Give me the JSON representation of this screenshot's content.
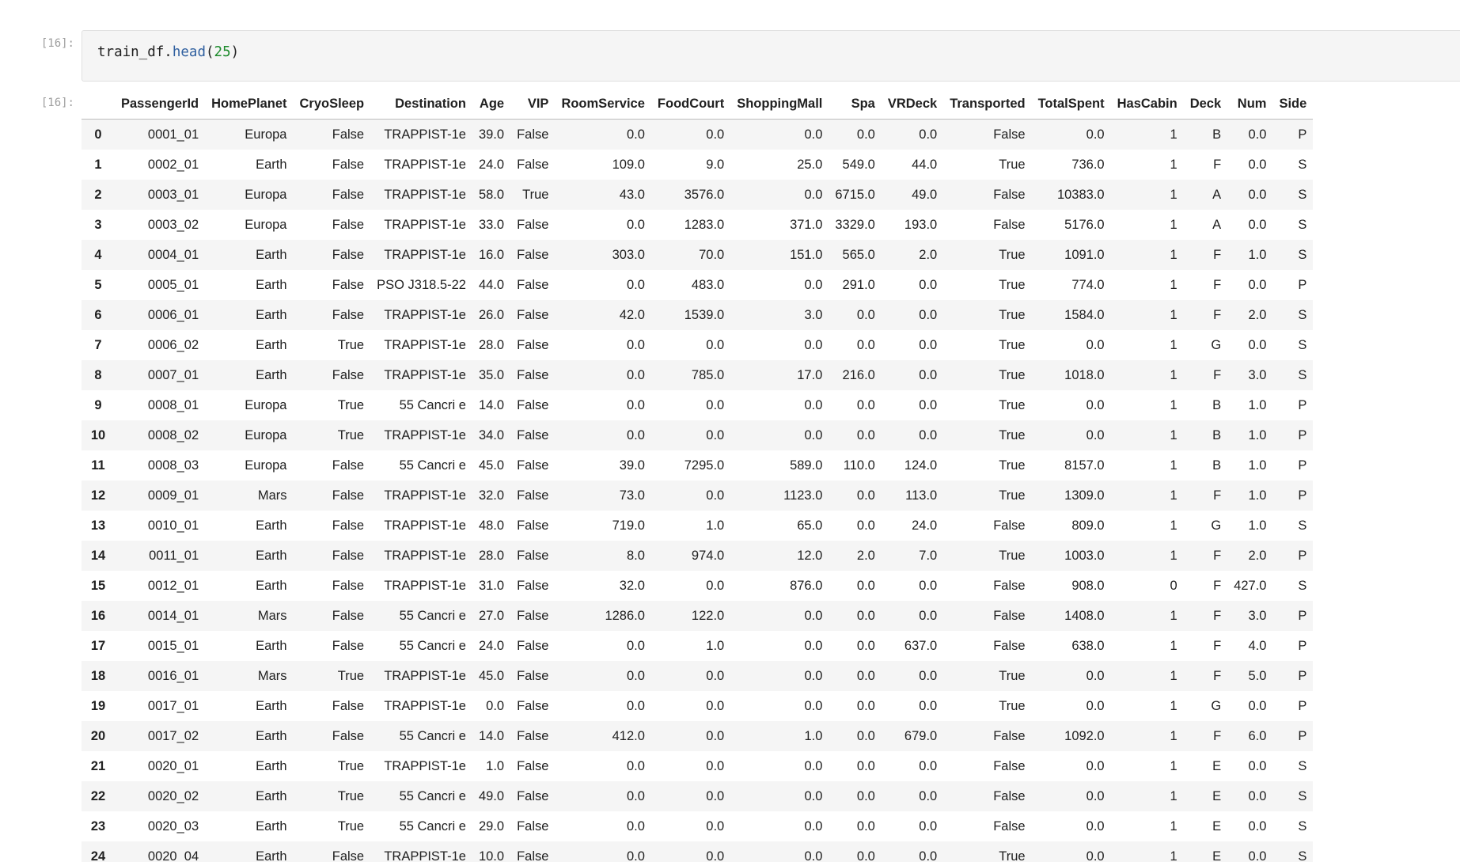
{
  "input_prompt": "[16]:",
  "output_prompt": "[16]:",
  "code": {
    "variable": "train_df",
    "dot": ".",
    "method": "head",
    "open_paren": "(",
    "argument": "25",
    "close_paren": ")"
  },
  "table": {
    "index_header": "",
    "columns": [
      "PassengerId",
      "HomePlanet",
      "CryoSleep",
      "Destination",
      "Age",
      "VIP",
      "RoomService",
      "FoodCourt",
      "ShoppingMall",
      "Spa",
      "VRDeck",
      "Transported",
      "TotalSpent",
      "HasCabin",
      "Deck",
      "Num",
      "Side"
    ],
    "rows": [
      {
        "index": "0",
        "cells": [
          "0001_01",
          "Europa",
          "False",
          "TRAPPIST-1e",
          "39.0",
          "False",
          "0.0",
          "0.0",
          "0.0",
          "0.0",
          "0.0",
          "False",
          "0.0",
          "1",
          "B",
          "0.0",
          "P"
        ]
      },
      {
        "index": "1",
        "cells": [
          "0002_01",
          "Earth",
          "False",
          "TRAPPIST-1e",
          "24.0",
          "False",
          "109.0",
          "9.0",
          "25.0",
          "549.0",
          "44.0",
          "True",
          "736.0",
          "1",
          "F",
          "0.0",
          "S"
        ]
      },
      {
        "index": "2",
        "cells": [
          "0003_01",
          "Europa",
          "False",
          "TRAPPIST-1e",
          "58.0",
          "True",
          "43.0",
          "3576.0",
          "0.0",
          "6715.0",
          "49.0",
          "False",
          "10383.0",
          "1",
          "A",
          "0.0",
          "S"
        ]
      },
      {
        "index": "3",
        "cells": [
          "0003_02",
          "Europa",
          "False",
          "TRAPPIST-1e",
          "33.0",
          "False",
          "0.0",
          "1283.0",
          "371.0",
          "3329.0",
          "193.0",
          "False",
          "5176.0",
          "1",
          "A",
          "0.0",
          "S"
        ]
      },
      {
        "index": "4",
        "cells": [
          "0004_01",
          "Earth",
          "False",
          "TRAPPIST-1e",
          "16.0",
          "False",
          "303.0",
          "70.0",
          "151.0",
          "565.0",
          "2.0",
          "True",
          "1091.0",
          "1",
          "F",
          "1.0",
          "S"
        ]
      },
      {
        "index": "5",
        "cells": [
          "0005_01",
          "Earth",
          "False",
          "PSO J318.5-22",
          "44.0",
          "False",
          "0.0",
          "483.0",
          "0.0",
          "291.0",
          "0.0",
          "True",
          "774.0",
          "1",
          "F",
          "0.0",
          "P"
        ]
      },
      {
        "index": "6",
        "cells": [
          "0006_01",
          "Earth",
          "False",
          "TRAPPIST-1e",
          "26.0",
          "False",
          "42.0",
          "1539.0",
          "3.0",
          "0.0",
          "0.0",
          "True",
          "1584.0",
          "1",
          "F",
          "2.0",
          "S"
        ]
      },
      {
        "index": "7",
        "cells": [
          "0006_02",
          "Earth",
          "True",
          "TRAPPIST-1e",
          "28.0",
          "False",
          "0.0",
          "0.0",
          "0.0",
          "0.0",
          "0.0",
          "True",
          "0.0",
          "1",
          "G",
          "0.0",
          "S"
        ]
      },
      {
        "index": "8",
        "cells": [
          "0007_01",
          "Earth",
          "False",
          "TRAPPIST-1e",
          "35.0",
          "False",
          "0.0",
          "785.0",
          "17.0",
          "216.0",
          "0.0",
          "True",
          "1018.0",
          "1",
          "F",
          "3.0",
          "S"
        ]
      },
      {
        "index": "9",
        "cells": [
          "0008_01",
          "Europa",
          "True",
          "55 Cancri e",
          "14.0",
          "False",
          "0.0",
          "0.0",
          "0.0",
          "0.0",
          "0.0",
          "True",
          "0.0",
          "1",
          "B",
          "1.0",
          "P"
        ]
      },
      {
        "index": "10",
        "cells": [
          "0008_02",
          "Europa",
          "True",
          "TRAPPIST-1e",
          "34.0",
          "False",
          "0.0",
          "0.0",
          "0.0",
          "0.0",
          "0.0",
          "True",
          "0.0",
          "1",
          "B",
          "1.0",
          "P"
        ]
      },
      {
        "index": "11",
        "cells": [
          "0008_03",
          "Europa",
          "False",
          "55 Cancri e",
          "45.0",
          "False",
          "39.0",
          "7295.0",
          "589.0",
          "110.0",
          "124.0",
          "True",
          "8157.0",
          "1",
          "B",
          "1.0",
          "P"
        ]
      },
      {
        "index": "12",
        "cells": [
          "0009_01",
          "Mars",
          "False",
          "TRAPPIST-1e",
          "32.0",
          "False",
          "73.0",
          "0.0",
          "1123.0",
          "0.0",
          "113.0",
          "True",
          "1309.0",
          "1",
          "F",
          "1.0",
          "P"
        ]
      },
      {
        "index": "13",
        "cells": [
          "0010_01",
          "Earth",
          "False",
          "TRAPPIST-1e",
          "48.0",
          "False",
          "719.0",
          "1.0",
          "65.0",
          "0.0",
          "24.0",
          "False",
          "809.0",
          "1",
          "G",
          "1.0",
          "S"
        ]
      },
      {
        "index": "14",
        "cells": [
          "0011_01",
          "Earth",
          "False",
          "TRAPPIST-1e",
          "28.0",
          "False",
          "8.0",
          "974.0",
          "12.0",
          "2.0",
          "7.0",
          "True",
          "1003.0",
          "1",
          "F",
          "2.0",
          "P"
        ]
      },
      {
        "index": "15",
        "cells": [
          "0012_01",
          "Earth",
          "False",
          "TRAPPIST-1e",
          "31.0",
          "False",
          "32.0",
          "0.0",
          "876.0",
          "0.0",
          "0.0",
          "False",
          "908.0",
          "0",
          "F",
          "427.0",
          "S"
        ]
      },
      {
        "index": "16",
        "cells": [
          "0014_01",
          "Mars",
          "False",
          "55 Cancri e",
          "27.0",
          "False",
          "1286.0",
          "122.0",
          "0.0",
          "0.0",
          "0.0",
          "False",
          "1408.0",
          "1",
          "F",
          "3.0",
          "P"
        ]
      },
      {
        "index": "17",
        "cells": [
          "0015_01",
          "Earth",
          "False",
          "55 Cancri e",
          "24.0",
          "False",
          "0.0",
          "1.0",
          "0.0",
          "0.0",
          "637.0",
          "False",
          "638.0",
          "1",
          "F",
          "4.0",
          "P"
        ]
      },
      {
        "index": "18",
        "cells": [
          "0016_01",
          "Mars",
          "True",
          "TRAPPIST-1e",
          "45.0",
          "False",
          "0.0",
          "0.0",
          "0.0",
          "0.0",
          "0.0",
          "True",
          "0.0",
          "1",
          "F",
          "5.0",
          "P"
        ]
      },
      {
        "index": "19",
        "cells": [
          "0017_01",
          "Earth",
          "False",
          "TRAPPIST-1e",
          "0.0",
          "False",
          "0.0",
          "0.0",
          "0.0",
          "0.0",
          "0.0",
          "True",
          "0.0",
          "1",
          "G",
          "0.0",
          "P"
        ]
      },
      {
        "index": "20",
        "cells": [
          "0017_02",
          "Earth",
          "False",
          "55 Cancri e",
          "14.0",
          "False",
          "412.0",
          "0.0",
          "1.0",
          "0.0",
          "679.0",
          "False",
          "1092.0",
          "1",
          "F",
          "6.0",
          "P"
        ]
      },
      {
        "index": "21",
        "cells": [
          "0020_01",
          "Earth",
          "True",
          "TRAPPIST-1e",
          "1.0",
          "False",
          "0.0",
          "0.0",
          "0.0",
          "0.0",
          "0.0",
          "False",
          "0.0",
          "1",
          "E",
          "0.0",
          "S"
        ]
      },
      {
        "index": "22",
        "cells": [
          "0020_02",
          "Earth",
          "True",
          "55 Cancri e",
          "49.0",
          "False",
          "0.0",
          "0.0",
          "0.0",
          "0.0",
          "0.0",
          "False",
          "0.0",
          "1",
          "E",
          "0.0",
          "S"
        ]
      },
      {
        "index": "23",
        "cells": [
          "0020_03",
          "Earth",
          "True",
          "55 Cancri e",
          "29.0",
          "False",
          "0.0",
          "0.0",
          "0.0",
          "0.0",
          "0.0",
          "False",
          "0.0",
          "1",
          "E",
          "0.0",
          "S"
        ]
      },
      {
        "index": "24",
        "cells": [
          "0020_04",
          "Earth",
          "False",
          "TRAPPIST-1e",
          "10.0",
          "False",
          "0.0",
          "0.0",
          "0.0",
          "0.0",
          "0.0",
          "True",
          "0.0",
          "1",
          "E",
          "0.0",
          "S"
        ]
      }
    ]
  }
}
